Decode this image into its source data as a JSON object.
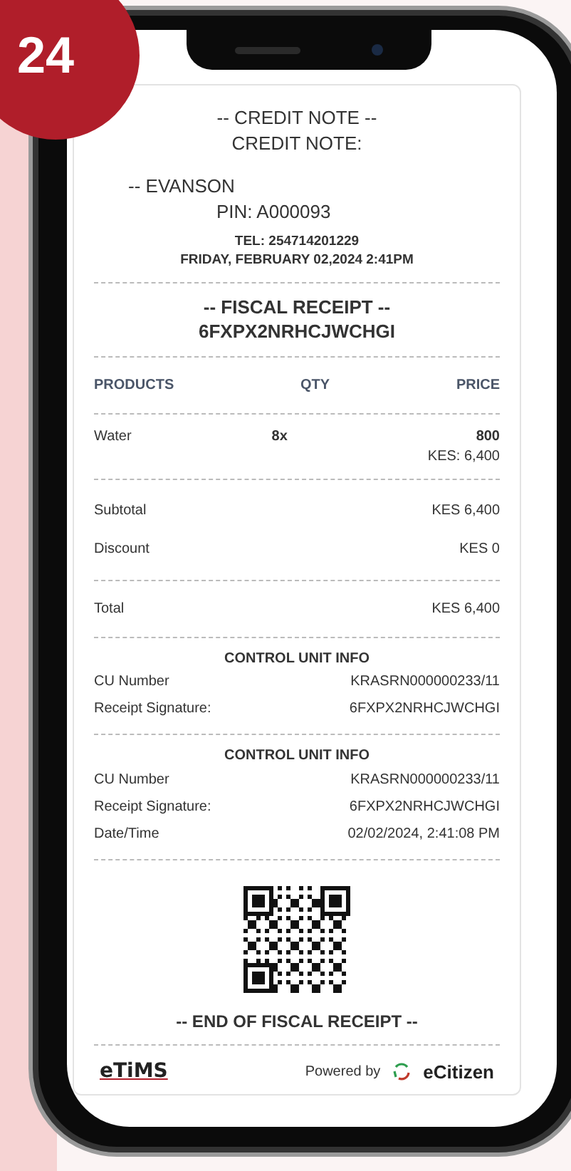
{
  "badge": "24",
  "header": {
    "title": "-- CREDIT NOTE --",
    "subtitle": "CREDIT NOTE:",
    "customer": "-- EVANSON",
    "pin": "PIN: A000093",
    "tel": "TEL: 254714201229",
    "date": "FRIDAY, FEBRUARY 02,2024 2:41PM"
  },
  "fiscal": {
    "title": "-- FISCAL RECEIPT --",
    "code": "6FXPX2NRHCJWCHGI"
  },
  "table": {
    "columns": [
      "PRODUCTS",
      "QTY",
      "PRICE"
    ],
    "rows": [
      {
        "product": "Water",
        "qty": "8x",
        "price": "800",
        "amount": "KES: 6,400"
      }
    ]
  },
  "summary": [
    {
      "label": "Subtotal",
      "value": "KES 6,400"
    },
    {
      "label": "Discount",
      "value": "KES 0"
    }
  ],
  "total": {
    "label": "Total",
    "value": "KES 6,400"
  },
  "control_units": [
    {
      "title": "CONTROL UNIT INFO",
      "rows": [
        {
          "label": "CU Number",
          "value": "KRASRN000000233/11"
        },
        {
          "label": "Receipt Signature:",
          "value": "6FXPX2NRHCJWCHGI"
        }
      ]
    },
    {
      "title": "CONTROL UNIT INFO",
      "rows": [
        {
          "label": "CU Number",
          "value": "KRASRN000000233/11"
        },
        {
          "label": "Receipt Signature:",
          "value": "6FXPX2NRHCJWCHGI"
        },
        {
          "label": "Date/Time",
          "value": "02/02/2024, 2:41:08 PM"
        }
      ]
    }
  ],
  "footer": {
    "end": "-- END OF FISCAL RECEIPT --",
    "logo": "eTiMS",
    "powered_by": "Powered by",
    "brand": "eCitizen"
  }
}
